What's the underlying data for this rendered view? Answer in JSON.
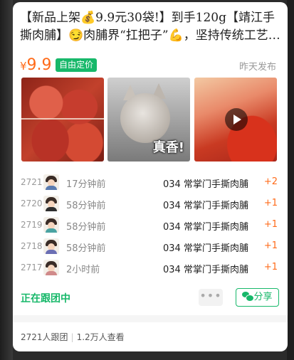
{
  "post": {
    "title": "【新品上架💰9.9元30袋!】到手120g【靖江手撕肉脯】😏肉脯界“扛把子”💪，坚持传统工艺出品",
    "price_symbol": "¥",
    "price_value": "9.9",
    "badge": "自由定价",
    "posted": "昨天发布"
  },
  "photos": {
    "cat_caption": "真香!"
  },
  "orders": [
    {
      "no": "2721",
      "time": "17分钟前",
      "item": "034 常掌门手撕肉脯",
      "qty": "+2"
    },
    {
      "no": "2720",
      "time": "58分钟前",
      "item": "034 常掌门手撕肉脯",
      "qty": "+1"
    },
    {
      "no": "2719",
      "time": "58分钟前",
      "item": "034 常掌门手撕肉脯",
      "qty": "+1"
    },
    {
      "no": "2718",
      "time": "58分钟前",
      "item": "034 常掌门手撕肉脯",
      "qty": "+1"
    },
    {
      "no": "2717",
      "time": "2小时前",
      "item": "034 常掌门手撕肉脯",
      "qty": "+1"
    }
  ],
  "actions": {
    "status": "正在跟团中",
    "more": "•••",
    "share": "分享"
  },
  "footer": {
    "joined": "2721人跟团",
    "views": "1.2万人查看"
  },
  "colors": {
    "accent_green": "#17b86a",
    "price_orange": "#ff6b1a"
  }
}
